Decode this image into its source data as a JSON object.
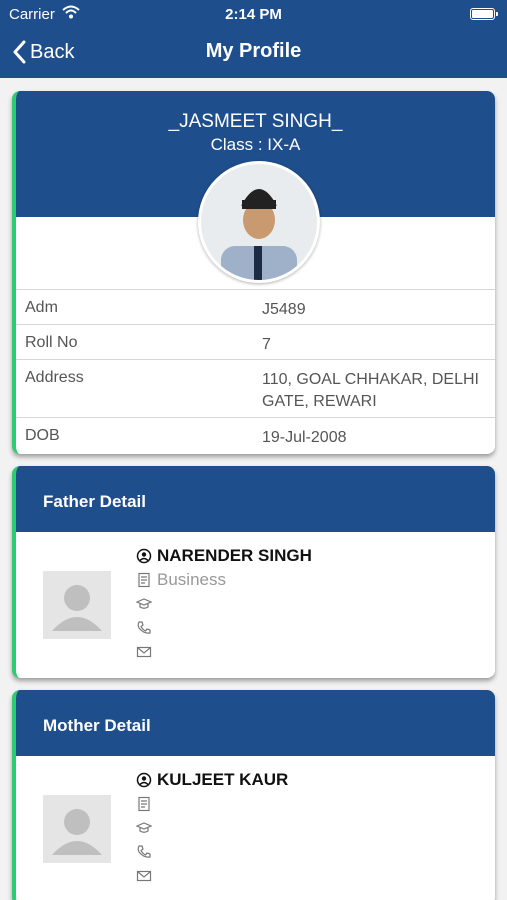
{
  "status_bar": {
    "carrier": "Carrier",
    "time": "2:14 PM"
  },
  "nav": {
    "back_label": "Back",
    "title": "My Profile"
  },
  "student": {
    "name": "_JASMEET SINGH_",
    "class_label": "Class : IX-A",
    "details": [
      {
        "label": "Adm",
        "value": "J5489"
      },
      {
        "label": "Roll No",
        "value": "7"
      },
      {
        "label": "Address",
        "value": "110, GOAL CHHAKAR, DELHI GATE, REWARI"
      },
      {
        "label": "DOB",
        "value": "19-Jul-2008"
      }
    ]
  },
  "father": {
    "heading": "Father Detail",
    "name": "NARENDER SINGH",
    "occupation": "Business",
    "qualification": "",
    "phone": "",
    "email": ""
  },
  "mother": {
    "heading": "Mother Detail",
    "name": "KULJEET KAUR",
    "occupation": "",
    "qualification": "",
    "phone": "",
    "email": ""
  },
  "icons": [
    "wifi-icon",
    "battery-icon",
    "chevron-left-icon",
    "person-icon",
    "occupation-icon",
    "graduation-cap-icon",
    "phone-icon",
    "mail-icon",
    "avatar-placeholder-icon"
  ],
  "colors": {
    "header_blue": "#1f4e8c",
    "accent_green": "#2ecc71"
  }
}
